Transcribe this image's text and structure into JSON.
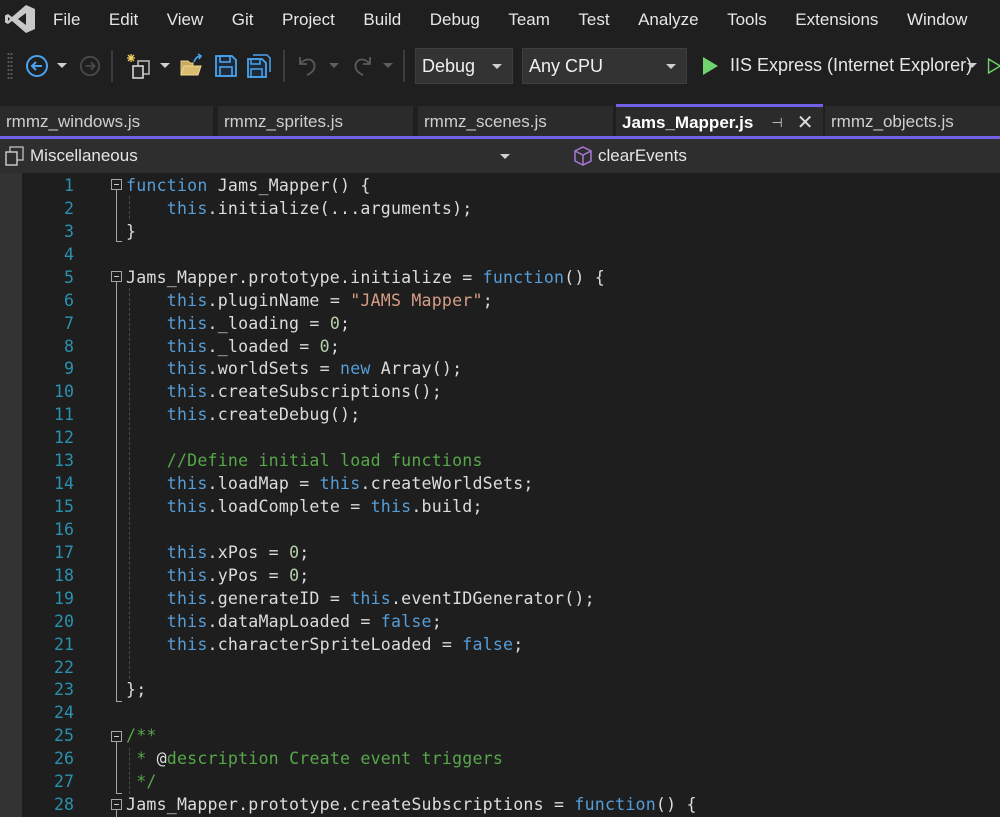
{
  "menubar": {
    "logo_icon": "visual-studio-logo-icon",
    "items": [
      "File",
      "Edit",
      "View",
      "Git",
      "Project",
      "Build",
      "Debug",
      "Team",
      "Test",
      "Analyze",
      "Tools",
      "Extensions",
      "Window"
    ]
  },
  "toolbar": {
    "icons": [
      "navigate-back-icon",
      "navigate-forward-icon",
      "new-project-icon",
      "open-file-icon",
      "save-icon",
      "save-all-icon",
      "undo-icon",
      "redo-icon",
      "start-icon",
      "start-without-debugging-icon"
    ],
    "configuration": "Debug",
    "platform": "Any CPU",
    "run_target": "IIS Express (Internet Explorer)"
  },
  "tabs": [
    {
      "label": "rmmz_windows.js",
      "active": false
    },
    {
      "label": "rmmz_sprites.js",
      "active": false
    },
    {
      "label": "rmmz_scenes.js",
      "active": false
    },
    {
      "label": "Jams_Mapper.js",
      "active": true
    },
    {
      "label": "rmmz_objects.js",
      "active": false
    }
  ],
  "navbar": {
    "project_scope": "Miscellaneous",
    "member": "clearEvents"
  },
  "colors": {
    "accent": "#7160e8",
    "keyword": "#569cd6",
    "string": "#d69d85",
    "number": "#b5cea8",
    "comment": "#57a64a",
    "line_number": "#2b91af",
    "plain": "#dcdcdc"
  },
  "editor": {
    "lines": [
      {
        "n": "1",
        "tokens": [
          [
            "kw",
            "function"
          ],
          [
            "pl",
            " Jams_Mapper() {"
          ]
        ]
      },
      {
        "n": "2",
        "tokens": [
          [
            "pl",
            "    "
          ],
          [
            "kw",
            "this"
          ],
          [
            "pl",
            ".initialize(...arguments);"
          ]
        ]
      },
      {
        "n": "3",
        "tokens": [
          [
            "pl",
            "}"
          ]
        ]
      },
      {
        "n": "4",
        "tokens": []
      },
      {
        "n": "5",
        "tokens": [
          [
            "pl",
            "Jams_Mapper.prototype.initialize = "
          ],
          [
            "kw",
            "function"
          ],
          [
            "pl",
            "() {"
          ]
        ]
      },
      {
        "n": "6",
        "tokens": [
          [
            "pl",
            "    "
          ],
          [
            "kw",
            "this"
          ],
          [
            "pl",
            ".pluginName = "
          ],
          [
            "str",
            "\"JAMS Mapper\""
          ],
          [
            "pl",
            ";"
          ]
        ]
      },
      {
        "n": "7",
        "tokens": [
          [
            "pl",
            "    "
          ],
          [
            "kw",
            "this"
          ],
          [
            "pl",
            "._loading = "
          ],
          [
            "num",
            "0"
          ],
          [
            "pl",
            ";"
          ]
        ]
      },
      {
        "n": "8",
        "tokens": [
          [
            "pl",
            "    "
          ],
          [
            "kw",
            "this"
          ],
          [
            "pl",
            "._loaded = "
          ],
          [
            "num",
            "0"
          ],
          [
            "pl",
            ";"
          ]
        ]
      },
      {
        "n": "9",
        "tokens": [
          [
            "pl",
            "    "
          ],
          [
            "kw",
            "this"
          ],
          [
            "pl",
            ".worldSets = "
          ],
          [
            "kw",
            "new"
          ],
          [
            "pl",
            " Array();"
          ]
        ]
      },
      {
        "n": "10",
        "tokens": [
          [
            "pl",
            "    "
          ],
          [
            "kw",
            "this"
          ],
          [
            "pl",
            ".createSubscriptions();"
          ]
        ]
      },
      {
        "n": "11",
        "tokens": [
          [
            "pl",
            "    "
          ],
          [
            "kw",
            "this"
          ],
          [
            "pl",
            ".createDebug();"
          ]
        ]
      },
      {
        "n": "12",
        "tokens": []
      },
      {
        "n": "13",
        "tokens": [
          [
            "pl",
            "    "
          ],
          [
            "cm",
            "//Define initial load functions"
          ]
        ]
      },
      {
        "n": "14",
        "tokens": [
          [
            "pl",
            "    "
          ],
          [
            "kw",
            "this"
          ],
          [
            "pl",
            ".loadMap = "
          ],
          [
            "kw",
            "this"
          ],
          [
            "pl",
            ".createWorldSets;"
          ]
        ]
      },
      {
        "n": "15",
        "tokens": [
          [
            "pl",
            "    "
          ],
          [
            "kw",
            "this"
          ],
          [
            "pl",
            ".loadComplete = "
          ],
          [
            "kw",
            "this"
          ],
          [
            "pl",
            ".build;"
          ]
        ]
      },
      {
        "n": "16",
        "tokens": []
      },
      {
        "n": "17",
        "tokens": [
          [
            "pl",
            "    "
          ],
          [
            "kw",
            "this"
          ],
          [
            "pl",
            ".xPos = "
          ],
          [
            "num",
            "0"
          ],
          [
            "pl",
            ";"
          ]
        ]
      },
      {
        "n": "18",
        "tokens": [
          [
            "pl",
            "    "
          ],
          [
            "kw",
            "this"
          ],
          [
            "pl",
            ".yPos = "
          ],
          [
            "num",
            "0"
          ],
          [
            "pl",
            ";"
          ]
        ]
      },
      {
        "n": "19",
        "tokens": [
          [
            "pl",
            "    "
          ],
          [
            "kw",
            "this"
          ],
          [
            "pl",
            ".generateID = "
          ],
          [
            "kw",
            "this"
          ],
          [
            "pl",
            ".eventIDGenerator();"
          ]
        ]
      },
      {
        "n": "20",
        "tokens": [
          [
            "pl",
            "    "
          ],
          [
            "kw",
            "this"
          ],
          [
            "pl",
            ".dataMapLoaded = "
          ],
          [
            "kw",
            "false"
          ],
          [
            "pl",
            ";"
          ]
        ]
      },
      {
        "n": "21",
        "tokens": [
          [
            "pl",
            "    "
          ],
          [
            "kw",
            "this"
          ],
          [
            "pl",
            ".characterSpriteLoaded = "
          ],
          [
            "kw",
            "false"
          ],
          [
            "pl",
            ";"
          ]
        ]
      },
      {
        "n": "22",
        "tokens": []
      },
      {
        "n": "23",
        "tokens": [
          [
            "pl",
            "};"
          ]
        ]
      },
      {
        "n": "24",
        "tokens": []
      },
      {
        "n": "25",
        "tokens": [
          [
            "cm",
            "/**"
          ]
        ]
      },
      {
        "n": "26",
        "tokens": [
          [
            "cm",
            " * "
          ],
          [
            "pl",
            "@"
          ],
          [
            "cm",
            "description Create event triggers"
          ]
        ]
      },
      {
        "n": "27",
        "tokens": [
          [
            "cm",
            " */"
          ]
        ]
      },
      {
        "n": "28",
        "tokens": [
          [
            "pl",
            "Jams_Mapper.prototype.createSubscriptions = "
          ],
          [
            "kw",
            "function"
          ],
          [
            "pl",
            "() {"
          ]
        ]
      }
    ]
  }
}
